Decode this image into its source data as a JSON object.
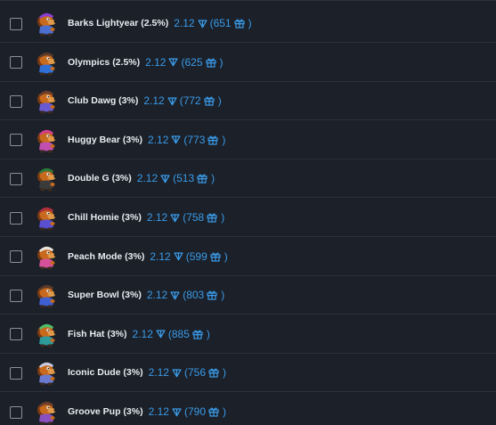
{
  "items": [
    {
      "name": "Barks Lightyear (2.5%)",
      "price": "2.12",
      "count": "651",
      "hat": "#8a3fd1",
      "shirt": "#4a6fd1"
    },
    {
      "name": "Olympics (2.5%)",
      "price": "2.12",
      "count": "625",
      "hat": "#5a3b2a",
      "shirt": "#2f6fd6"
    },
    {
      "name": "Club Dawg (3%)",
      "price": "2.12",
      "count": "772",
      "hat": "#6b3d2a",
      "shirt": "#6a5ad1"
    },
    {
      "name": "Huggy Bear (3%)",
      "price": "2.12",
      "count": "773",
      "hat": "#d13f8a",
      "shirt": "#c04fb0"
    },
    {
      "name": "Double G (3%)",
      "price": "2.12",
      "count": "513",
      "hat": "#2f7a3b",
      "shirt": "#3b3b3b"
    },
    {
      "name": "Chill Homie (3%)",
      "price": "2.12",
      "count": "758",
      "hat": "#b0303a",
      "shirt": "#5a4fd1"
    },
    {
      "name": "Peach Mode (3%)",
      "price": "2.12",
      "count": "599",
      "hat": "#e9e4dc",
      "shirt": "#d64f9a"
    },
    {
      "name": "Super Bowl (3%)",
      "price": "2.12",
      "count": "803",
      "hat": "#5a3b2a",
      "shirt": "#3f5fd1"
    },
    {
      "name": "Fish Hat (3%)",
      "price": "2.12",
      "count": "885",
      "hat": "#4fbf6a",
      "shirt": "#2f9a9a"
    },
    {
      "name": "Iconic Dude (3%)",
      "price": "2.12",
      "count": "756",
      "hat": "#c8cbe0",
      "shirt": "#6a7ad1"
    },
    {
      "name": "Groove Pup (3%)",
      "price": "2.12",
      "count": "790",
      "hat": "#6b3d2a",
      "shirt": "#8a4fc0"
    }
  ],
  "icons": {
    "currency": "ton-diamond-icon",
    "gift": "gift-icon"
  },
  "colors": {
    "background": "#1b2029",
    "accent": "#3b9be8",
    "text": "#e8ecf1"
  }
}
